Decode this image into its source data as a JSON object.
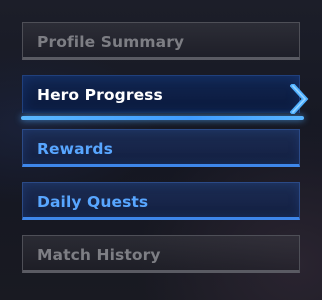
{
  "menu": {
    "items": [
      {
        "label": "Profile Summary",
        "state": "disabled"
      },
      {
        "label": "Hero Progress",
        "state": "active"
      },
      {
        "label": "Rewards",
        "state": "normal"
      },
      {
        "label": "Daily Quests",
        "state": "normal"
      },
      {
        "label": "Match History",
        "state": "disabled"
      }
    ],
    "active_indicator_icon": "chevron-right-icon"
  },
  "colors": {
    "accent_blue": "#3f9cff",
    "label_blue": "#58a6ff",
    "active_label": "#ffffff",
    "disabled_label": "#7d7e84"
  }
}
